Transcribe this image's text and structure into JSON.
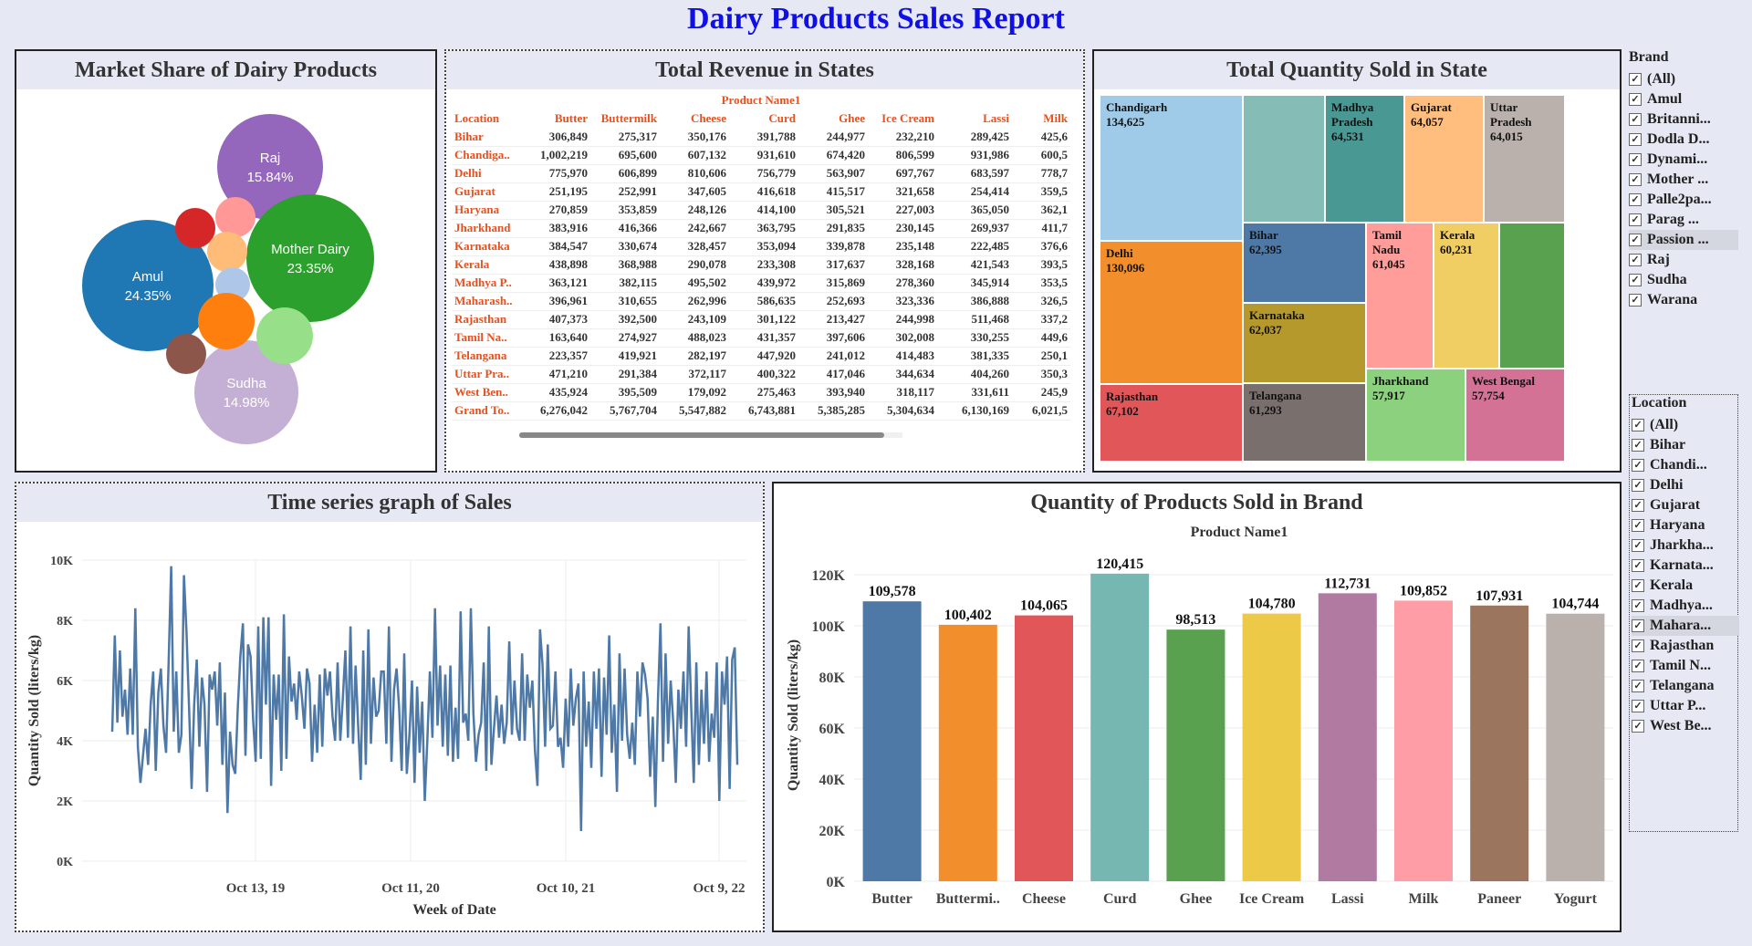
{
  "report_title": "Dairy Products Sales Report",
  "market_share": {
    "title": "Market Share of Dairy Products",
    "chart_data": {
      "type": "bubble",
      "bubbles": [
        {
          "label": "Raj",
          "value_label": "15.84%",
          "color": "#9467bd"
        },
        {
          "label": "Amul",
          "value_label": "24.35%",
          "color": "#1f77b4"
        },
        {
          "label": "Mother Dairy",
          "value_label": "23.35%",
          "color": "#2ca02c"
        },
        {
          "label": "Sudha",
          "value_label": "14.98%",
          "color": "#c5b0d5"
        },
        {
          "label": "",
          "value_label": "",
          "color": "#d62728"
        },
        {
          "label": "",
          "value_label": "",
          "color": "#ff9896"
        },
        {
          "label": "",
          "value_label": "",
          "color": "#ffbb78"
        },
        {
          "label": "",
          "value_label": "",
          "color": "#aec7e8"
        },
        {
          "label": "",
          "value_label": "",
          "color": "#ff7f0e"
        },
        {
          "label": "",
          "value_label": "",
          "color": "#98df8a"
        },
        {
          "label": "",
          "value_label": "",
          "color": "#8c564b"
        }
      ]
    }
  },
  "revenue": {
    "title": "Total Revenue in States",
    "group_header": "Product Name1",
    "chart_data": {
      "type": "table",
      "row_header": "Location",
      "columns": [
        "Butter",
        "Buttermilk",
        "Cheese",
        "Curd",
        "Ghee",
        "Ice Cream",
        "Lassi",
        "Milk"
      ],
      "rows": [
        {
          "label": "Bihar",
          "values": [
            "306,849",
            "275,317",
            "350,176",
            "391,788",
            "244,977",
            "232,210",
            "289,425",
            "425,6"
          ]
        },
        {
          "label": "Chandiga..",
          "values": [
            "1,002,219",
            "695,600",
            "607,132",
            "931,610",
            "674,420",
            "806,599",
            "931,986",
            "600,5"
          ]
        },
        {
          "label": "Delhi",
          "values": [
            "775,970",
            "606,899",
            "810,606",
            "756,779",
            "563,907",
            "697,767",
            "683,597",
            "778,7"
          ]
        },
        {
          "label": "Gujarat",
          "values": [
            "251,195",
            "252,991",
            "347,605",
            "416,618",
            "415,517",
            "321,658",
            "254,414",
            "359,5"
          ]
        },
        {
          "label": "Haryana",
          "values": [
            "270,859",
            "353,859",
            "248,126",
            "414,100",
            "305,521",
            "227,003",
            "365,050",
            "362,1"
          ]
        },
        {
          "label": "Jharkhand",
          "values": [
            "383,916",
            "416,366",
            "242,667",
            "363,795",
            "291,835",
            "230,145",
            "269,937",
            "411,7"
          ]
        },
        {
          "label": "Karnataka",
          "values": [
            "384,547",
            "330,674",
            "328,457",
            "353,094",
            "339,878",
            "235,148",
            "222,485",
            "376,6"
          ]
        },
        {
          "label": "Kerala",
          "values": [
            "438,898",
            "368,988",
            "290,078",
            "233,308",
            "317,637",
            "328,168",
            "421,543",
            "393,5"
          ]
        },
        {
          "label": "Madhya P..",
          "values": [
            "363,121",
            "382,115",
            "495,502",
            "439,972",
            "315,869",
            "278,360",
            "345,914",
            "353,5"
          ]
        },
        {
          "label": "Maharash..",
          "values": [
            "396,961",
            "310,655",
            "262,996",
            "586,635",
            "252,693",
            "323,336",
            "386,888",
            "326,5"
          ]
        },
        {
          "label": "Rajasthan",
          "values": [
            "407,373",
            "392,500",
            "243,109",
            "301,122",
            "213,427",
            "244,998",
            "511,468",
            "337,2"
          ]
        },
        {
          "label": "Tamil Na..",
          "values": [
            "163,640",
            "274,927",
            "488,023",
            "431,357",
            "397,606",
            "302,008",
            "330,255",
            "449,6"
          ]
        },
        {
          "label": "Telangana",
          "values": [
            "223,357",
            "419,921",
            "282,197",
            "447,920",
            "241,012",
            "414,483",
            "381,335",
            "250,1"
          ]
        },
        {
          "label": "Uttar Pra..",
          "values": [
            "471,210",
            "291,384",
            "372,117",
            "400,322",
            "417,046",
            "344,634",
            "404,260",
            "350,3"
          ]
        },
        {
          "label": "West Ben..",
          "values": [
            "435,924",
            "395,509",
            "179,092",
            "275,463",
            "393,940",
            "318,117",
            "331,611",
            "245,9"
          ]
        },
        {
          "label": "Grand To..",
          "values": [
            "6,276,042",
            "5,767,704",
            "5,547,882",
            "6,743,881",
            "5,385,285",
            "5,304,634",
            "6,130,169",
            "6,021,5"
          ]
        }
      ]
    }
  },
  "quantity_state": {
    "title": "Total Quantity Sold in State",
    "chart_data": {
      "type": "treemap",
      "tiles": [
        {
          "label": "Chandigarh",
          "value": "134,625",
          "color": "#a0cbe8"
        },
        {
          "label": "",
          "value": "",
          "color": "#86bcb6"
        },
        {
          "label": "Madhya Pradesh",
          "value": "64,531",
          "color": "#499894"
        },
        {
          "label": "Gujarat",
          "value": "64,057",
          "color": "#ffbe7d"
        },
        {
          "label": "Uttar Pradesh",
          "value": "64,015",
          "color": "#bab0ac"
        },
        {
          "label": "Delhi",
          "value": "130,096",
          "color": "#f28e2b"
        },
        {
          "label": "Bihar",
          "value": "62,395",
          "color": "#4e79a7"
        },
        {
          "label": "Tamil Nadu",
          "value": "61,045",
          "color": "#ff9d9a"
        },
        {
          "label": "Kerala",
          "value": "60,231",
          "color": "#f1ce63"
        },
        {
          "label": "",
          "value": "",
          "color": "#59a14f"
        },
        {
          "label": "Karnataka",
          "value": "62,037",
          "color": "#b6992d"
        },
        {
          "label": "Rajasthan",
          "value": "67,102",
          "color": "#e15759"
        },
        {
          "label": "Telangana",
          "value": "61,293",
          "color": "#79706e"
        },
        {
          "label": "Jharkhand",
          "value": "57,917",
          "color": "#8cd17d"
        },
        {
          "label": "West Bengal",
          "value": "57,754",
          "color": "#d37295"
        }
      ]
    }
  },
  "time_series": {
    "title": "Time series graph of Sales",
    "chart_data": {
      "type": "line",
      "xlabel": "Week of Date",
      "ylabel": "Quantity Sold (liters/kg)",
      "x_ticks": [
        "Oct 13, 19",
        "Oct 11, 20",
        "Oct 10, 21",
        "Oct 9, 22"
      ],
      "y_ticks": [
        "0K",
        "2K",
        "4K",
        "6K",
        "8K",
        "10K"
      ],
      "ylim": [
        0,
        10000
      ],
      "color": "#4e79a7",
      "values": [
        4300,
        7500,
        4600,
        7000,
        4800,
        5700,
        4200,
        6400,
        4200,
        8400,
        3800,
        2600,
        3500,
        4400,
        3200,
        5200,
        6300,
        3000,
        5600,
        6400,
        4500,
        3600,
        6600,
        9800,
        4300,
        6300,
        3600,
        4200,
        9500,
        7600,
        5100,
        2400,
        5200,
        6700,
        3800,
        6100,
        5200,
        2300,
        6200,
        5700,
        6300,
        4500,
        6600,
        3200,
        5600,
        1600,
        4300,
        3200,
        2900,
        5100,
        6800,
        7900,
        3500,
        7200,
        6800,
        4700,
        3300,
        7800,
        3400,
        8100,
        5200,
        8100,
        2500,
        6200,
        4700,
        6200,
        3000,
        8200,
        3400,
        6800,
        5300,
        5900,
        4700,
        6300,
        5500,
        4400,
        6400,
        5900,
        3300,
        5200,
        3600,
        6200,
        3800,
        6400,
        5500,
        6300,
        4800,
        4000,
        6600,
        4000,
        5400,
        7000,
        4100,
        7800,
        3900,
        6500,
        4500,
        2700,
        7000,
        3200,
        7700,
        3900,
        6100,
        4800,
        5000,
        6300,
        6300,
        3900,
        7800,
        3300,
        5700,
        6400,
        5100,
        3000,
        6900,
        2900,
        4200,
        6000,
        2600,
        5800,
        3600,
        5300,
        2000,
        4000,
        6300,
        4100,
        8400,
        4500,
        6500,
        3800,
        6200,
        3500,
        6500,
        3300,
        5100,
        3400,
        8300,
        4600,
        4900,
        4000,
        8400,
        4900,
        3300,
        4200,
        4600,
        6600,
        3000,
        7800,
        3200,
        4400,
        5500,
        4100,
        5200,
        3900,
        4600,
        7300,
        4200,
        6000,
        4400,
        4000,
        6900,
        4000,
        6200,
        5100,
        6000,
        3700,
        2500,
        7700,
        6500,
        3800,
        7200,
        4400,
        4500,
        6300,
        3800,
        4100,
        3100,
        5400,
        3800,
        6400,
        4500,
        5400,
        5900,
        1000,
        6300,
        3800,
        5300,
        3100,
        6300,
        4400,
        6400,
        2800,
        6100,
        4200,
        7500,
        3600,
        5200,
        2300,
        6900,
        4000,
        6400,
        4200,
        3400,
        4600,
        3200,
        6300,
        4800,
        6600,
        6200,
        5400,
        2800,
        4800,
        1800,
        5300,
        7900,
        3300,
        6900,
        3900,
        6000,
        4600,
        2600,
        5700,
        4400,
        6300,
        3800,
        7800,
        5100,
        2600,
        6600,
        3200,
        5700,
        3900,
        6300,
        3300,
        4900,
        4100,
        6600,
        2000,
        6300,
        5200,
        6800,
        2400,
        6700,
        7100,
        3200
      ]
    }
  },
  "brand_qty": {
    "title": "Quantity of Products Sold in Brand",
    "chart_data": {
      "type": "bar",
      "subtitle": "Product Name1",
      "ylabel": "Quantity Sold (liters/kg)",
      "y_ticks": [
        "0K",
        "20K",
        "40K",
        "60K",
        "80K",
        "100K",
        "120K"
      ],
      "ylim": [
        0,
        130000
      ],
      "categories": [
        "Butter",
        "Buttermi..",
        "Cheese",
        "Curd",
        "Ghee",
        "Ice Cream",
        "Lassi",
        "Milk",
        "Paneer",
        "Yogurt"
      ],
      "values": [
        109578,
        100402,
        104065,
        120415,
        98513,
        104780,
        112731,
        109852,
        107931,
        104744
      ],
      "value_labels": [
        "109,578",
        "100,402",
        "104,065",
        "120,415",
        "98,513",
        "104,780",
        "112,731",
        "109,852",
        "107,931",
        "104,744"
      ],
      "colors": [
        "#4e79a7",
        "#f28e2b",
        "#e15759",
        "#76b7b2",
        "#59a14f",
        "#edc948",
        "#b07aa1",
        "#ff9da7",
        "#9c755f",
        "#bab0ac"
      ]
    }
  },
  "filters": {
    "brand": {
      "title": "Brand",
      "items": [
        {
          "label": "(All)",
          "checked": true
        },
        {
          "label": "Amul",
          "checked": true
        },
        {
          "label": "Britanni...",
          "checked": true
        },
        {
          "label": "Dodla D...",
          "checked": true
        },
        {
          "label": "Dynami...",
          "checked": true
        },
        {
          "label": "Mother ...",
          "checked": true
        },
        {
          "label": "Palle2pa...",
          "checked": true
        },
        {
          "label": "Parag ...",
          "checked": true
        },
        {
          "label": "Passion ...",
          "checked": true,
          "selected": true
        },
        {
          "label": "Raj",
          "checked": true
        },
        {
          "label": "Sudha",
          "checked": true
        },
        {
          "label": "Warana",
          "checked": true
        }
      ]
    },
    "location": {
      "title": "Location",
      "items": [
        {
          "label": "(All)",
          "checked": true
        },
        {
          "label": "Bihar",
          "checked": true
        },
        {
          "label": "Chandi...",
          "checked": true
        },
        {
          "label": "Delhi",
          "checked": true
        },
        {
          "label": "Gujarat",
          "checked": true
        },
        {
          "label": "Haryana",
          "checked": true
        },
        {
          "label": "Jharkha...",
          "checked": true
        },
        {
          "label": "Karnata...",
          "checked": true
        },
        {
          "label": "Kerala",
          "checked": true
        },
        {
          "label": "Madhya...",
          "checked": true
        },
        {
          "label": "Mahara...",
          "checked": true,
          "selected": true
        },
        {
          "label": "Rajasthan",
          "checked": true
        },
        {
          "label": "Tamil N...",
          "checked": true
        },
        {
          "label": "Telangana",
          "checked": true
        },
        {
          "label": "Uttar P...",
          "checked": true
        },
        {
          "label": "West Be...",
          "checked": true
        }
      ]
    }
  }
}
